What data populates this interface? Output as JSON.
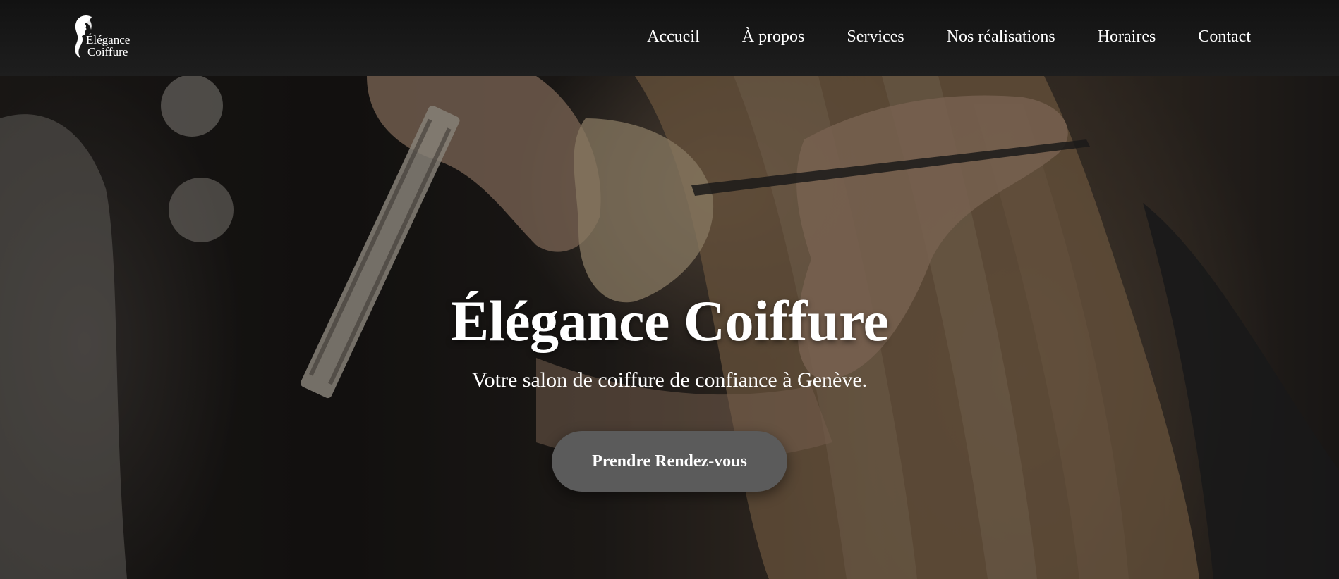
{
  "brand": {
    "logo_line1": "Élégance",
    "logo_line2": "Coiffure",
    "logo_icon": "woman-silhouette-icon"
  },
  "nav": {
    "items": [
      {
        "label": "Accueil"
      },
      {
        "label": "À propos"
      },
      {
        "label": "Services"
      },
      {
        "label": "Nos réalisations"
      },
      {
        "label": "Horaires"
      },
      {
        "label": "Contact"
      }
    ]
  },
  "hero": {
    "title": "Élégance Coiffure",
    "subtitle": "Votre salon de coiffure de confiance à Genève.",
    "cta_label": "Prendre Rendez-vous",
    "background_image": "hairdresser-cutting-blonde-hair-photo"
  },
  "colors": {
    "navbar_bg": "#1a1a1a",
    "cta_bg": "#5b5b5b",
    "text": "#ffffff"
  }
}
